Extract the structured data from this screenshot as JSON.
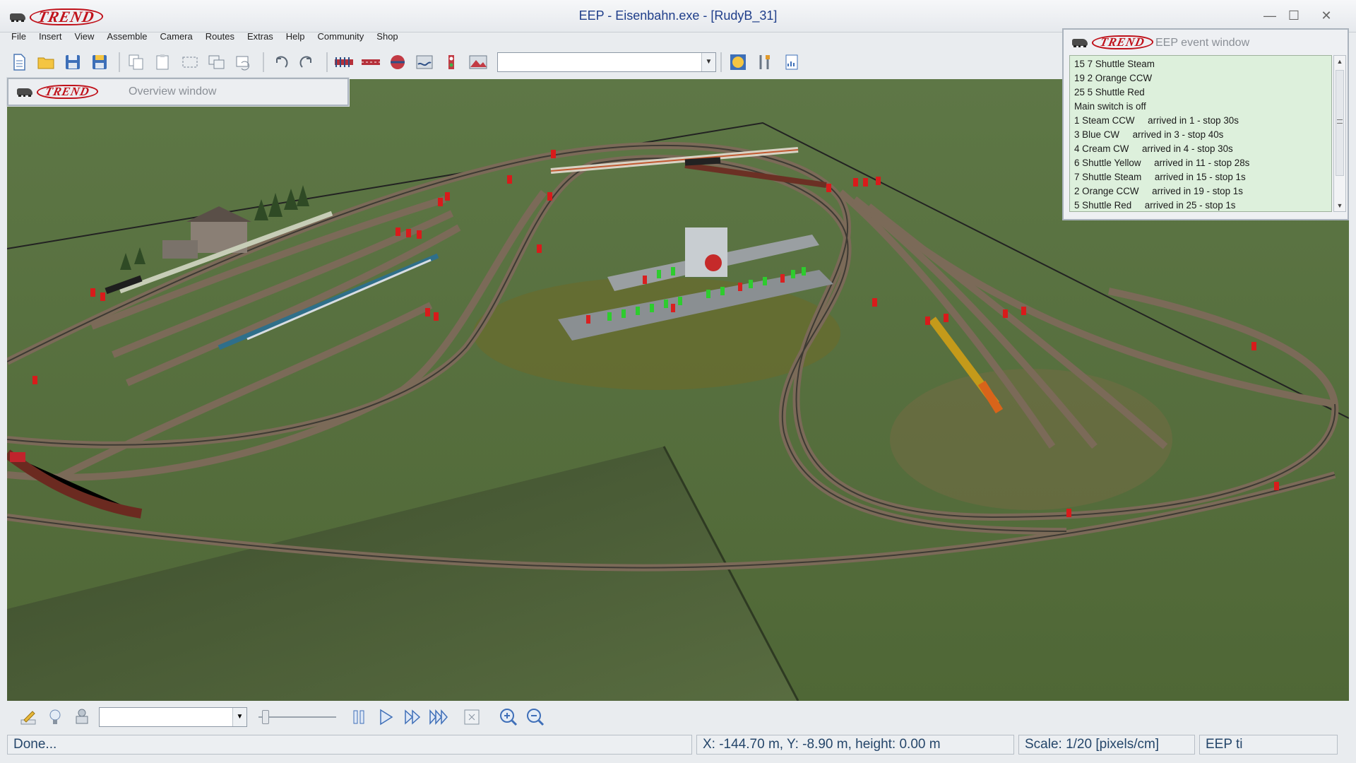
{
  "window": {
    "title": "EEP - Eisenbahn.exe - [RudyB_31]",
    "brand": "TREND",
    "minimize": "—",
    "maximize": "☐",
    "close": "✕"
  },
  "menu": [
    "File",
    "Insert",
    "View",
    "Assemble",
    "Camera",
    "Routes",
    "Extras",
    "Help",
    "Community",
    "Shop"
  ],
  "toolbar": {
    "object_select_value": "",
    "object_select_arrow": "▼"
  },
  "overview": {
    "brand": "TREND",
    "title": "Overview window"
  },
  "event_window": {
    "brand": "TREND",
    "title": "EEP event window",
    "scroll_up": "▲",
    "scroll_down": "▼",
    "lines": [
      "15 7 Shuttle Steam",
      "19 2 Orange CCW",
      "25 5 Shuttle Red",
      "Main switch is off",
      "1 Steam CCW     arrived in 1 - stop 30s",
      "3 Blue CW     arrived in 3 - stop 40s",
      "4 Cream CW     arrived in 4 - stop 30s",
      "6 Shuttle Yellow     arrived in 11 - stop 28s",
      "7 Shuttle Steam     arrived in 15 - stop 1s",
      "2 Orange CCW     arrived in 19 - stop 1s",
      "5 Shuttle Red     arrived in 25 - stop 1s"
    ]
  },
  "controlbar": {
    "camera_select_value": "",
    "camera_select_arrow": "▼",
    "speed_level": 0.05
  },
  "status": {
    "message": "Done...",
    "coordinates": "X: -144.70 m, Y: -8.90 m, height: 0.00 m",
    "scale": "Scale: 1/20 [pixels/cm]",
    "app_truncated": "EEP ti"
  },
  "colors": {
    "title_text": "#1f3e8a",
    "brand_red": "#c0121b",
    "terrain": "#5b7340",
    "event_bg": "#ddf0dc",
    "status_text": "#25466a"
  }
}
